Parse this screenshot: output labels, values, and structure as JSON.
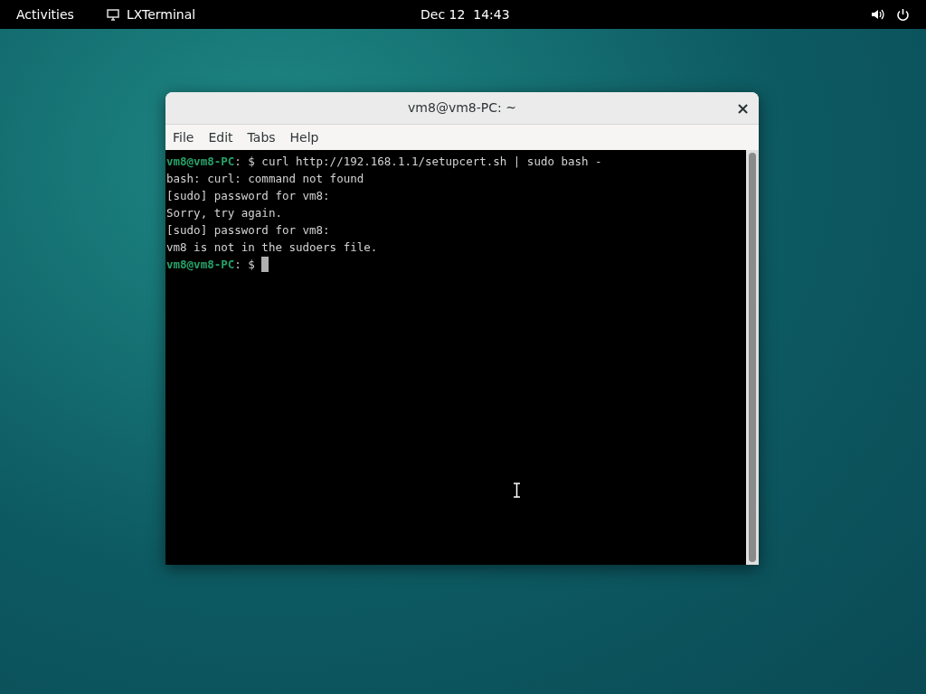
{
  "top_bar": {
    "activities": "Activities",
    "app_name": "LXTerminal",
    "clock": "Dec 12  14:43"
  },
  "window": {
    "title": "vm8@vm8-PC: ~",
    "close": "×"
  },
  "menu": [
    "File",
    "Edit",
    "Tabs",
    "Help"
  ],
  "terminal": {
    "lines": [
      {
        "kind": "prompt",
        "prompt": "vm8@vm8-PC",
        "text": ": $ curl http://192.168.1.1/setupcert.sh | sudo bash -"
      },
      {
        "kind": "output",
        "text": "bash: curl: command not found"
      },
      {
        "kind": "output",
        "text": "[sudo] password for vm8:"
      },
      {
        "kind": "output",
        "text": "Sorry, try again."
      },
      {
        "kind": "output",
        "text": "[sudo] password for vm8:"
      },
      {
        "kind": "output",
        "text": "vm8 is not in the sudoers file."
      },
      {
        "kind": "prompt",
        "prompt": "vm8@vm8-PC",
        "text": ": $ "
      }
    ],
    "cursor": true
  }
}
